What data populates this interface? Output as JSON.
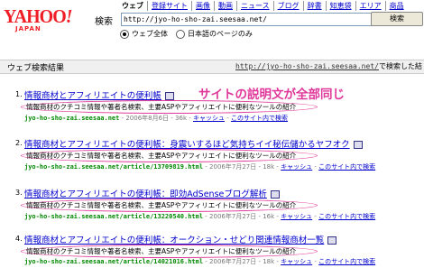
{
  "logo": {
    "text": "YAHOO",
    "bang": "!",
    "sub": "JAPAN"
  },
  "tabs": [
    "ウェブ",
    "登録サイト",
    "画像",
    "動画",
    "ニュース",
    "ブログ",
    "辞書",
    "知恵袋",
    "エリア",
    "商品"
  ],
  "search": {
    "label": "検索",
    "value": "http://jyo-ho-sho-zai.seesaa.net/",
    "button": "検索"
  },
  "scope": {
    "option1": "ウェブ全体",
    "option2": "日本語のページのみ",
    "selected": "option1"
  },
  "results_header": {
    "title": "ウェブ検索結果",
    "query_url": "http://jyo-ho-sho-zai.seesaa.net/",
    "suffix": "で検索した結"
  },
  "annotation": "サイトの説明文が全部同じ",
  "results": [
    {
      "num": "1.",
      "title": "情報商材とアフィリエイトの便利帳",
      "snippet": "情報商材のクチコミ情報や著者名検索、主要ASPやアフィリエイトに便利なツールの紹介",
      "url": "jyo-ho-sho-zai.seesaa.net",
      "info": " - 2006年8月6日 - 36k - ",
      "cache": "キャッシュ",
      "sep": " - ",
      "more": "このサイト内で検索"
    },
    {
      "num": "2.",
      "title": "情報商材とアフィリエイトの便利帳：身震いするほど気持ちイイ秘伝儲かるヤフオク",
      "snippet": "情報商材のクチコミ情報や著者名検索、主要ASPやアフィリエイトに便利なツールの紹介",
      "url": "jyo-ho-sho-zai.seesaa.net/article/13709819.html",
      "info": " - 2006年7月27日 - 18k - ",
      "cache": "キャッシュ",
      "sep": " - ",
      "more": "このサイト内で検索"
    },
    {
      "num": "3.",
      "title": "情報商材とアフィリエイトの便利帳：即効AdSenseブログ解析",
      "snippet": "情報商材のクチコミ情報や著者名検索、主要ASPやアフィリエイトに便利なツールの紹介",
      "url": "jyo-ho-sho-zai.seesaa.net/article/13220540.html",
      "info": " - 2006年7月27日 - 16k - ",
      "cache": "キャッシュ",
      "sep": " - ",
      "more": "このサイト内で検索"
    },
    {
      "num": "4.",
      "title": "情報商材とアフィリエイトの便利帳：オークション・せどり関連情報商材一覧",
      "snippet": "情報商材のクチコミ情報や著者名検索、主要ASPやアフィリエイトに便利なツールの紹介",
      "url": "jyo-ho-sho-zai.seesaa.net/article/14021016.html",
      "info": " - 2006年7月27日 - 18k - ",
      "cache": "キャッシュ",
      "sep": " - ",
      "more": "このサイト内で検索"
    }
  ]
}
